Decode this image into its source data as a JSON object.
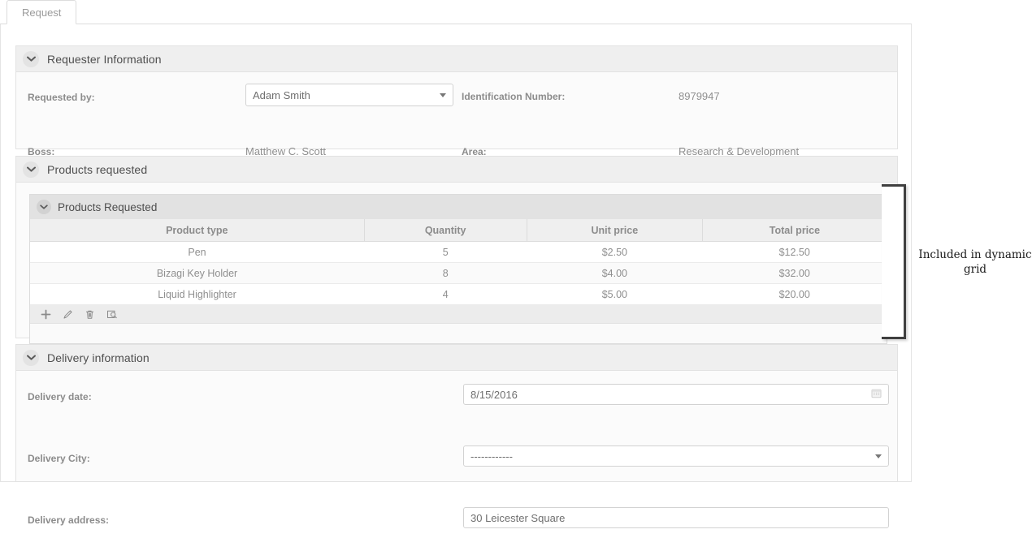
{
  "tab": {
    "label": "Request"
  },
  "sections": {
    "requester": {
      "title": "Requester Information",
      "chevron_icon": "chevron-down-icon",
      "fields": {
        "requested_by_label": "Requested by:",
        "requested_by_value": "Adam Smith",
        "identification_label": "Identification Number:",
        "identification_value": "8979947",
        "boss_label": "Boss:",
        "boss_value": "Matthew C. Scott",
        "area_label": "Area:",
        "area_value": "Research & Development"
      }
    },
    "products": {
      "title": "Products requested",
      "chevron_icon": "chevron-down-icon",
      "grid": {
        "title": "Products Requested",
        "chevron_icon": "chevron-down-icon",
        "columns": [
          "Product type",
          "Quantity",
          "Unit price",
          "Total price"
        ],
        "rows": [
          {
            "product_type": "Pen",
            "quantity": "5",
            "unit_price": "$2.50",
            "total_price": "$12.50"
          },
          {
            "product_type": "Bizagi Key Holder",
            "quantity": "8",
            "unit_price": "$4.00",
            "total_price": "$32.00"
          },
          {
            "product_type": "Liquid Highlighter",
            "quantity": "4",
            "unit_price": "$5.00",
            "total_price": "$20.00"
          }
        ],
        "toolbar": [
          {
            "name": "add-row-icon",
            "title": "Add"
          },
          {
            "name": "edit-row-icon",
            "title": "Edit"
          },
          {
            "name": "delete-row-icon",
            "title": "Delete"
          },
          {
            "name": "view-row-icon",
            "title": "View"
          }
        ]
      }
    },
    "delivery": {
      "title": "Delivery information",
      "chevron_icon": "chevron-down-icon",
      "fields": {
        "date_label": "Delivery date:",
        "date_value": "8/15/2016",
        "date_icon": "calendar-icon",
        "city_label": "Delivery City:",
        "city_value": "------------",
        "city_icon": "chevron-down-icon",
        "address_label": "Delivery address:",
        "address_value": "30 Leicester Square"
      }
    }
  },
  "annotation": {
    "text": "Included in dynamic grid"
  },
  "colors": {
    "section_header_bg": "#efefef",
    "grid_header_bg": "#e2e2e2",
    "border": "#e2e2e2",
    "label_text": "#8c8c8c",
    "value_text": "#8f8f8f",
    "annotation_text": "#1a1a1a"
  }
}
